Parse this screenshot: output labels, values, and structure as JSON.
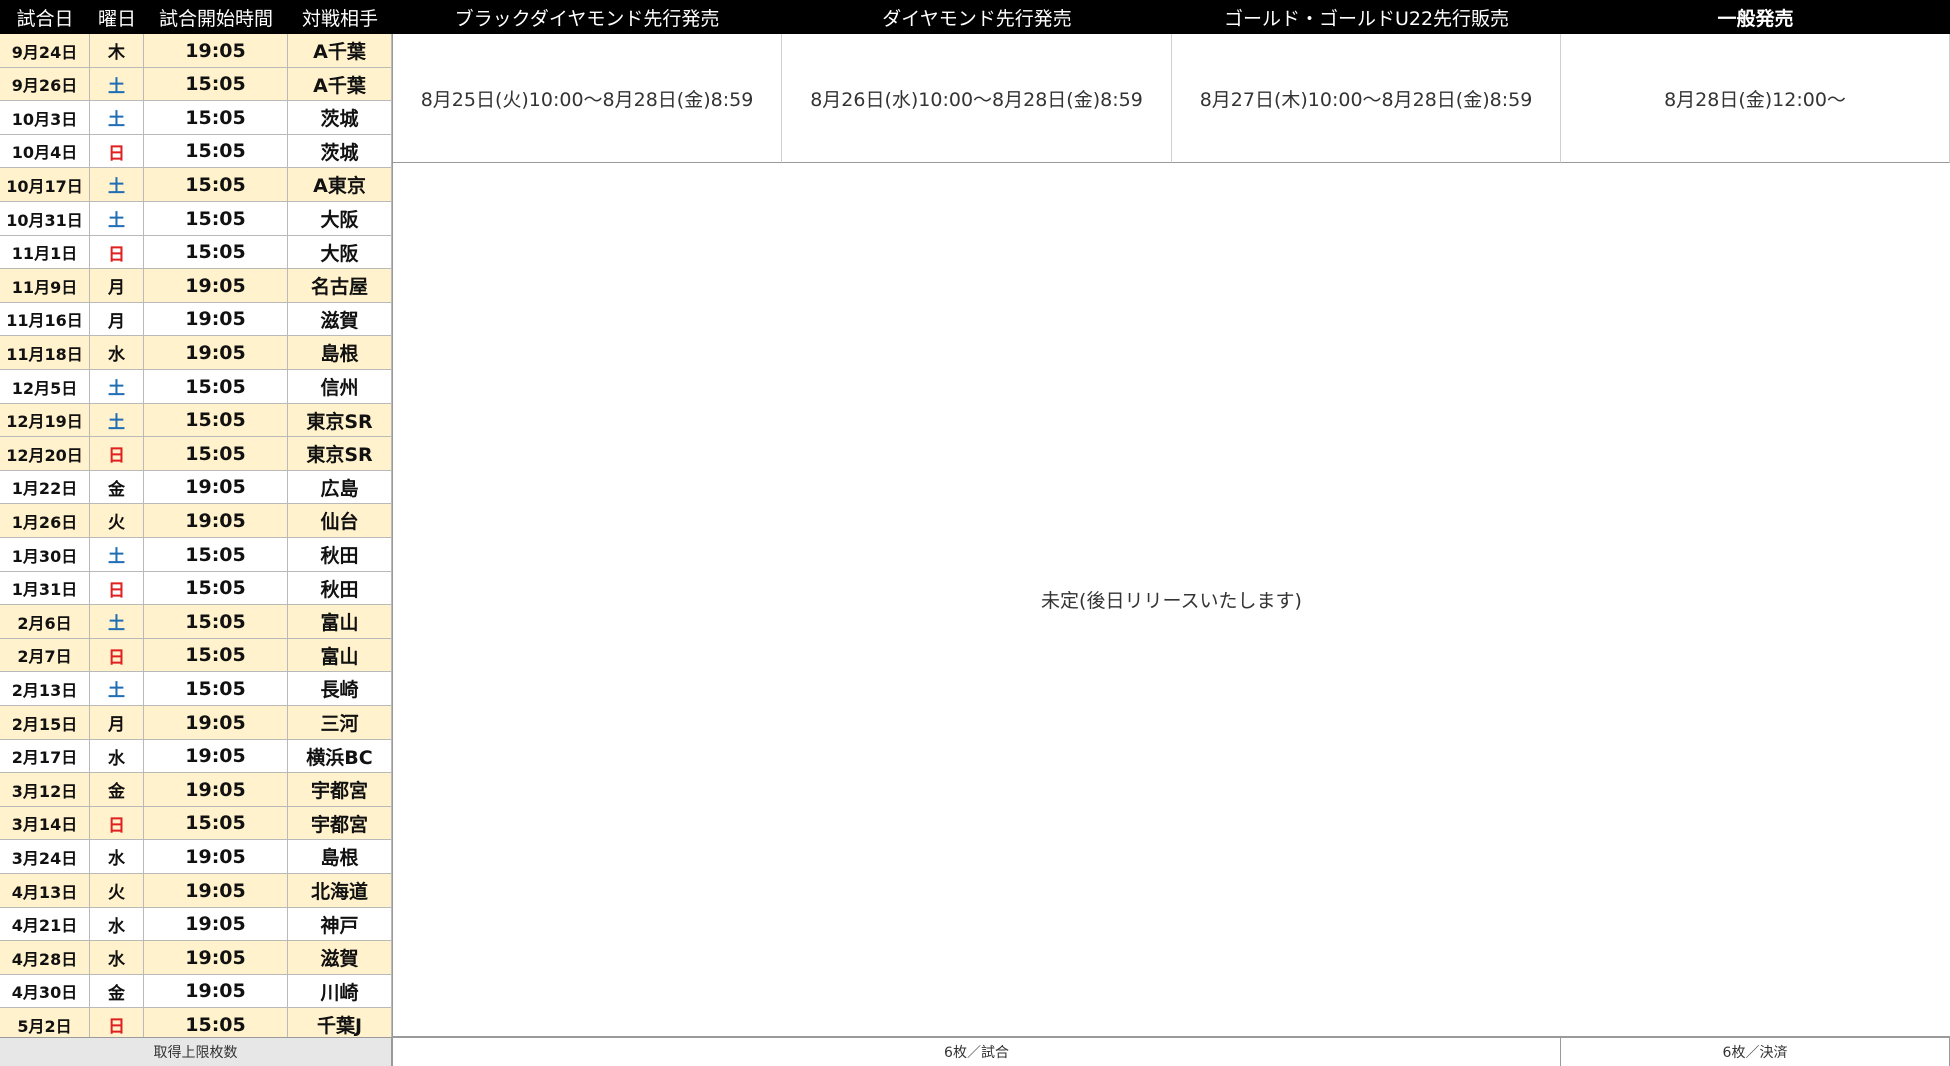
{
  "headers": {
    "date": "試合日",
    "dow": "曜日",
    "time": "試合開始時間",
    "opponent": "対戦相手",
    "black_diamond": "ブラックダイヤモンド先行発売",
    "diamond": "ダイヤモンド先行発売",
    "gold": "ゴールド・ゴールドU22先行販売",
    "general": "一般発売"
  },
  "sales": {
    "black_diamond": "8月25日(火)10:00〜8月28日(金)8:59",
    "diamond": "8月26日(水)10:00〜8月28日(金)8:59",
    "gold": "8月27日(木)10:00〜8月28日(金)8:59",
    "general": "8月28日(金)12:00〜"
  },
  "pending_note": "未定(後日リリースいたします)",
  "footer": {
    "label": "取得上限枚数",
    "per_game": "6枚／試合",
    "per_payment": "6枚／決済"
  },
  "colors": {
    "highlight_row": "#fff2cc",
    "saturday": "#1f6db5",
    "sunday": "#e02020",
    "header_bg": "#000000"
  },
  "games": [
    {
      "date": "9月24日",
      "dow": "木",
      "time": "19:05",
      "opponent": "A千葉",
      "highlight": true
    },
    {
      "date": "9月26日",
      "dow": "土",
      "time": "15:05",
      "opponent": "A千葉",
      "highlight": true
    },
    {
      "date": "10月3日",
      "dow": "土",
      "time": "15:05",
      "opponent": "茨城",
      "highlight": false
    },
    {
      "date": "10月4日",
      "dow": "日",
      "time": "15:05",
      "opponent": "茨城",
      "highlight": false
    },
    {
      "date": "10月17日",
      "dow": "土",
      "time": "15:05",
      "opponent": "A東京",
      "highlight": true
    },
    {
      "date": "10月31日",
      "dow": "土",
      "time": "15:05",
      "opponent": "大阪",
      "highlight": false
    },
    {
      "date": "11月1日",
      "dow": "日",
      "time": "15:05",
      "opponent": "大阪",
      "highlight": false
    },
    {
      "date": "11月9日",
      "dow": "月",
      "time": "19:05",
      "opponent": "名古屋",
      "highlight": true
    },
    {
      "date": "11月16日",
      "dow": "月",
      "time": "19:05",
      "opponent": "滋賀",
      "highlight": false
    },
    {
      "date": "11月18日",
      "dow": "水",
      "time": "19:05",
      "opponent": "島根",
      "highlight": true
    },
    {
      "date": "12月5日",
      "dow": "土",
      "time": "15:05",
      "opponent": "信州",
      "highlight": false
    },
    {
      "date": "12月19日",
      "dow": "土",
      "time": "15:05",
      "opponent": "東京SR",
      "highlight": true
    },
    {
      "date": "12月20日",
      "dow": "日",
      "time": "15:05",
      "opponent": "東京SR",
      "highlight": true
    },
    {
      "date": "1月22日",
      "dow": "金",
      "time": "19:05",
      "opponent": "広島",
      "highlight": false
    },
    {
      "date": "1月26日",
      "dow": "火",
      "time": "19:05",
      "opponent": "仙台",
      "highlight": true
    },
    {
      "date": "1月30日",
      "dow": "土",
      "time": "15:05",
      "opponent": "秋田",
      "highlight": false
    },
    {
      "date": "1月31日",
      "dow": "日",
      "time": "15:05",
      "opponent": "秋田",
      "highlight": false
    },
    {
      "date": "2月6日",
      "dow": "土",
      "time": "15:05",
      "opponent": "富山",
      "highlight": true
    },
    {
      "date": "2月7日",
      "dow": "日",
      "time": "15:05",
      "opponent": "富山",
      "highlight": true
    },
    {
      "date": "2月13日",
      "dow": "土",
      "time": "15:05",
      "opponent": "長崎",
      "highlight": false
    },
    {
      "date": "2月15日",
      "dow": "月",
      "time": "19:05",
      "opponent": "三河",
      "highlight": true
    },
    {
      "date": "2月17日",
      "dow": "水",
      "time": "19:05",
      "opponent": "横浜BC",
      "highlight": false
    },
    {
      "date": "3月12日",
      "dow": "金",
      "time": "19:05",
      "opponent": "宇都宮",
      "highlight": true
    },
    {
      "date": "3月14日",
      "dow": "日",
      "time": "15:05",
      "opponent": "宇都宮",
      "highlight": true
    },
    {
      "date": "3月24日",
      "dow": "水",
      "time": "19:05",
      "opponent": "島根",
      "highlight": false
    },
    {
      "date": "4月13日",
      "dow": "火",
      "time": "19:05",
      "opponent": "北海道",
      "highlight": true
    },
    {
      "date": "4月21日",
      "dow": "水",
      "time": "19:05",
      "opponent": "神戸",
      "highlight": false
    },
    {
      "date": "4月28日",
      "dow": "水",
      "time": "19:05",
      "opponent": "滋賀",
      "highlight": true
    },
    {
      "date": "4月30日",
      "dow": "金",
      "time": "19:05",
      "opponent": "川崎",
      "highlight": false
    },
    {
      "date": "5月2日",
      "dow": "日",
      "time": "15:05",
      "opponent": "千葉J",
      "highlight": true
    }
  ]
}
